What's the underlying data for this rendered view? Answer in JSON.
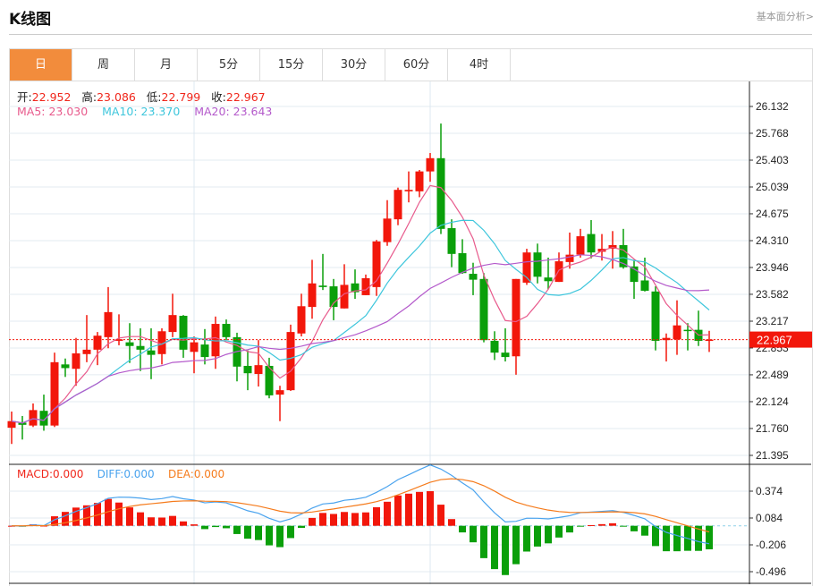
{
  "header": {
    "title": "K线图",
    "link": "基本面分析>"
  },
  "tabs": [
    {
      "label": "日",
      "active": true
    },
    {
      "label": "周"
    },
    {
      "label": "月"
    },
    {
      "label": "5分"
    },
    {
      "label": "15分"
    },
    {
      "label": "30分"
    },
    {
      "label": "60分"
    },
    {
      "label": "4时"
    }
  ],
  "ohlc_info": {
    "open_label": "开:",
    "open": "22.952",
    "high_label": "高:",
    "high": "23.086",
    "low_label": "低:",
    "low": "22.799",
    "close_label": "收:",
    "close": "22.967"
  },
  "ma_info": {
    "ma5": "MA5: 23.030",
    "ma10": "MA10: 23.370",
    "ma20": "MA20: 23.643"
  },
  "macd_info": {
    "macd": "MACD:0.000",
    "diff": "DIFF:0.000",
    "dea": "DEA:0.000"
  },
  "colors": {
    "up": "#f2170b",
    "down": "#0a9f0a",
    "ma5": "#e85a8c",
    "ma10": "#3ec6dc",
    "ma20": "#b45acb",
    "diff": "#4aa3ee",
    "dea": "#f57b1c",
    "accent": "#f28c3c"
  },
  "chart_data": {
    "type": "candlestick",
    "current_price": "22.967",
    "price_ticks": [
      "26.132",
      "25.768",
      "25.403",
      "25.039",
      "24.675",
      "24.310",
      "23.946",
      "23.582",
      "23.217",
      "22.853",
      "22.489",
      "22.124",
      "21.760",
      "21.395"
    ],
    "price_range": [
      21.395,
      26.132
    ],
    "macd_ticks": [
      "0.374",
      "0.084",
      "-0.206",
      "-0.496"
    ],
    "macd_range": [
      -0.496,
      0.374
    ],
    "candles_ohlc": [
      [
        21.77,
        21.99,
        21.55,
        21.86
      ],
      [
        21.84,
        21.93,
        21.61,
        21.81
      ],
      [
        21.8,
        22.1,
        21.78,
        22.01
      ],
      [
        22.0,
        22.22,
        21.73,
        21.8
      ],
      [
        21.8,
        22.79,
        21.78,
        22.66
      ],
      [
        22.63,
        22.71,
        22.46,
        22.58
      ],
      [
        22.57,
        22.99,
        22.34,
        22.78
      ],
      [
        22.77,
        23.3,
        22.66,
        22.83
      ],
      [
        22.83,
        23.07,
        22.62,
        23.02
      ],
      [
        23.0,
        23.68,
        22.85,
        23.34
      ],
      [
        22.95,
        23.31,
        22.89,
        22.97
      ],
      [
        22.93,
        23.19,
        22.65,
        22.88
      ],
      [
        22.88,
        23.12,
        22.54,
        22.83
      ],
      [
        22.82,
        23.12,
        22.43,
        22.76
      ],
      [
        22.77,
        23.12,
        22.63,
        23.08
      ],
      [
        23.07,
        23.59,
        23.0,
        23.3
      ],
      [
        23.29,
        23.3,
        22.72,
        22.83
      ],
      [
        22.8,
        23.01,
        22.51,
        22.93
      ],
      [
        22.9,
        23.11,
        22.63,
        22.73
      ],
      [
        22.74,
        23.28,
        22.57,
        23.18
      ],
      [
        23.18,
        23.24,
        22.96,
        23.0
      ],
      [
        23.0,
        23.06,
        22.4,
        22.6
      ],
      [
        22.61,
        22.82,
        22.28,
        22.51
      ],
      [
        22.5,
        22.96,
        22.33,
        22.62
      ],
      [
        22.61,
        22.72,
        22.17,
        22.21
      ],
      [
        22.22,
        22.34,
        21.86,
        22.28
      ],
      [
        22.28,
        23.17,
        22.27,
        23.07
      ],
      [
        23.05,
        23.59,
        23.01,
        23.42
      ],
      [
        23.41,
        24.05,
        23.25,
        23.73
      ],
      [
        23.7,
        24.13,
        23.64,
        23.68
      ],
      [
        23.69,
        23.79,
        23.23,
        23.41
      ],
      [
        23.39,
        23.99,
        23.39,
        23.71
      ],
      [
        23.73,
        23.92,
        23.52,
        23.61
      ],
      [
        23.57,
        23.85,
        23.57,
        23.8
      ],
      [
        23.68,
        24.32,
        23.56,
        24.3
      ],
      [
        24.29,
        24.86,
        24.24,
        24.61
      ],
      [
        24.6,
        25.03,
        24.52,
        25.0
      ],
      [
        24.98,
        25.25,
        24.83,
        25.0
      ],
      [
        24.98,
        25.27,
        24.9,
        25.25
      ],
      [
        25.25,
        25.5,
        25.11,
        25.43
      ],
      [
        25.43,
        25.9,
        24.4,
        24.47
      ],
      [
        24.48,
        24.6,
        23.95,
        24.13
      ],
      [
        24.14,
        24.33,
        23.86,
        23.87
      ],
      [
        23.86,
        24.01,
        23.57,
        23.78
      ],
      [
        23.79,
        23.87,
        22.93,
        22.96
      ],
      [
        22.95,
        23.08,
        22.69,
        22.79
      ],
      [
        22.79,
        23.12,
        22.67,
        22.73
      ],
      [
        22.74,
        23.79,
        22.49,
        23.79
      ],
      [
        23.74,
        24.2,
        23.71,
        24.15
      ],
      [
        24.15,
        24.27,
        23.73,
        23.82
      ],
      [
        23.81,
        24.08,
        23.65,
        23.76
      ],
      [
        23.75,
        24.15,
        23.75,
        24.03
      ],
      [
        24.02,
        24.42,
        23.93,
        24.12
      ],
      [
        24.12,
        24.47,
        24.08,
        24.37
      ],
      [
        24.4,
        24.59,
        24.07,
        24.15
      ],
      [
        24.16,
        24.4,
        24.04,
        24.2
      ],
      [
        24.2,
        24.44,
        23.93,
        24.25
      ],
      [
        24.25,
        24.47,
        23.93,
        23.95
      ],
      [
        23.96,
        24.05,
        23.52,
        23.75
      ],
      [
        23.77,
        24.08,
        23.62,
        23.63
      ],
      [
        23.62,
        23.69,
        22.82,
        22.95
      ],
      [
        22.96,
        23.05,
        22.67,
        22.99
      ],
      [
        22.97,
        23.5,
        22.76,
        23.16
      ],
      [
        23.1,
        23.19,
        22.82,
        23.09
      ],
      [
        23.1,
        23.36,
        22.88,
        22.95
      ],
      [
        22.952,
        23.086,
        22.799,
        22.967
      ]
    ]
  }
}
